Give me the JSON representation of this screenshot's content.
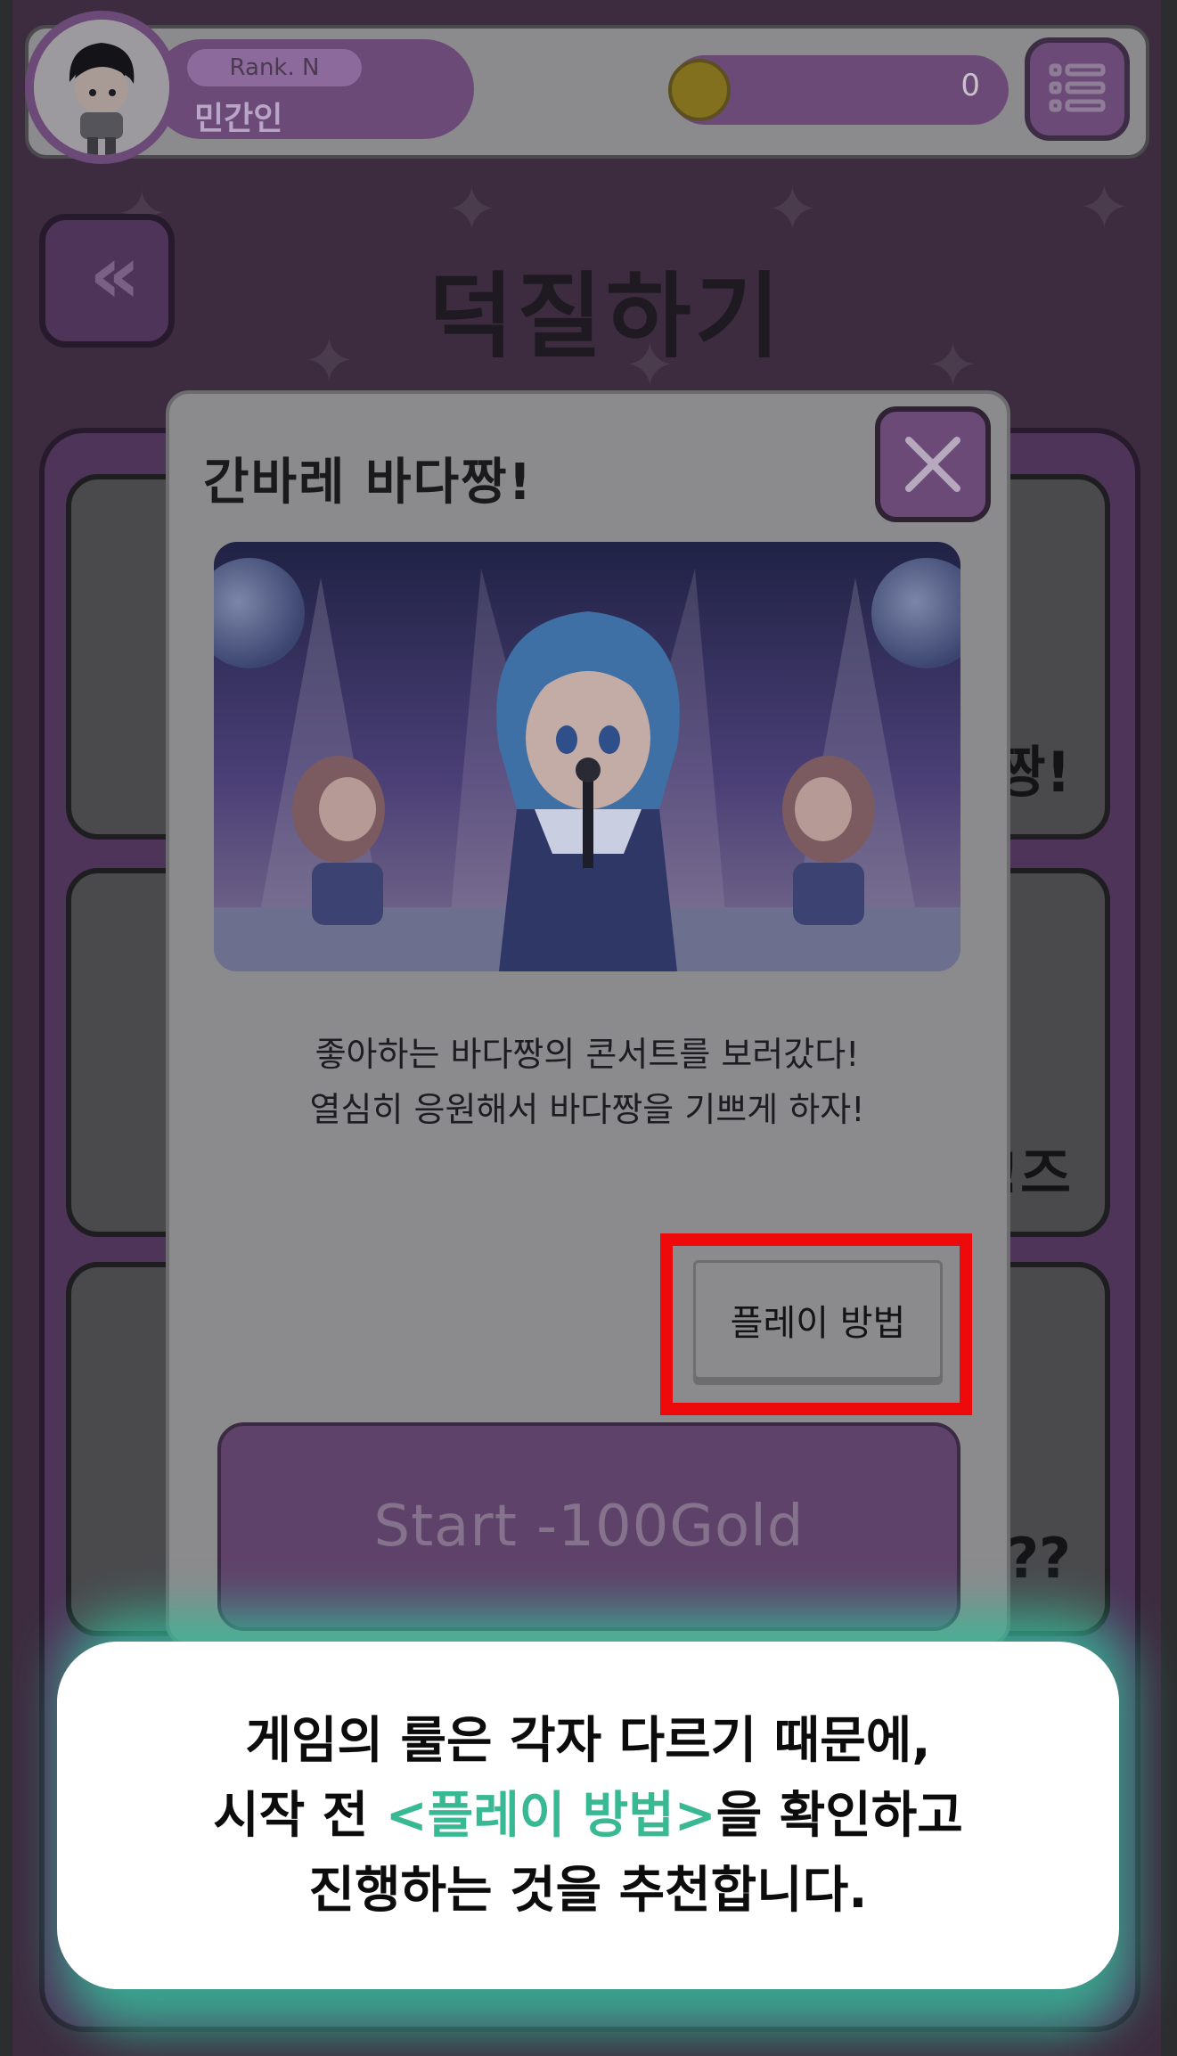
{
  "header": {
    "rank_label": "Rank. N",
    "user_name": "민간인",
    "gold_amount": "0",
    "menu_icon": "list-menu-icon",
    "coin_icon": "gold-coin-icon"
  },
  "screen": {
    "back_icon": "double-chevron-left-icon",
    "back_label": "«",
    "title": "덕질하기"
  },
  "background_cards": [
    {
      "visible_text": "짱!"
    },
    {
      "visible_text": "!즈"
    },
    {
      "visible_text": "??"
    }
  ],
  "modal": {
    "title": "간바레 바다짱!",
    "close_icon": "close-x-icon",
    "description_line1": "좋아하는 바다짱의 콘서트를 보러갔다!",
    "description_line2": "열심히 응원해서 바다짱을 기쁘게 하자!",
    "howto_button": "플레이 방법",
    "start_button": "Start -100Gold"
  },
  "tutorial": {
    "line1": "게임의 룰은 각자 다르기 때문에,",
    "line2_prefix": "시작 전 ",
    "line2_highlight": "<플레이 방법>",
    "line2_suffix": "을 확인하고",
    "line3": "진행하는 것을 추천합니다."
  },
  "colors": {
    "accent_purple": "#6b4a78",
    "highlight_red": "#ee0a0a",
    "tutorial_green": "#38b893"
  }
}
